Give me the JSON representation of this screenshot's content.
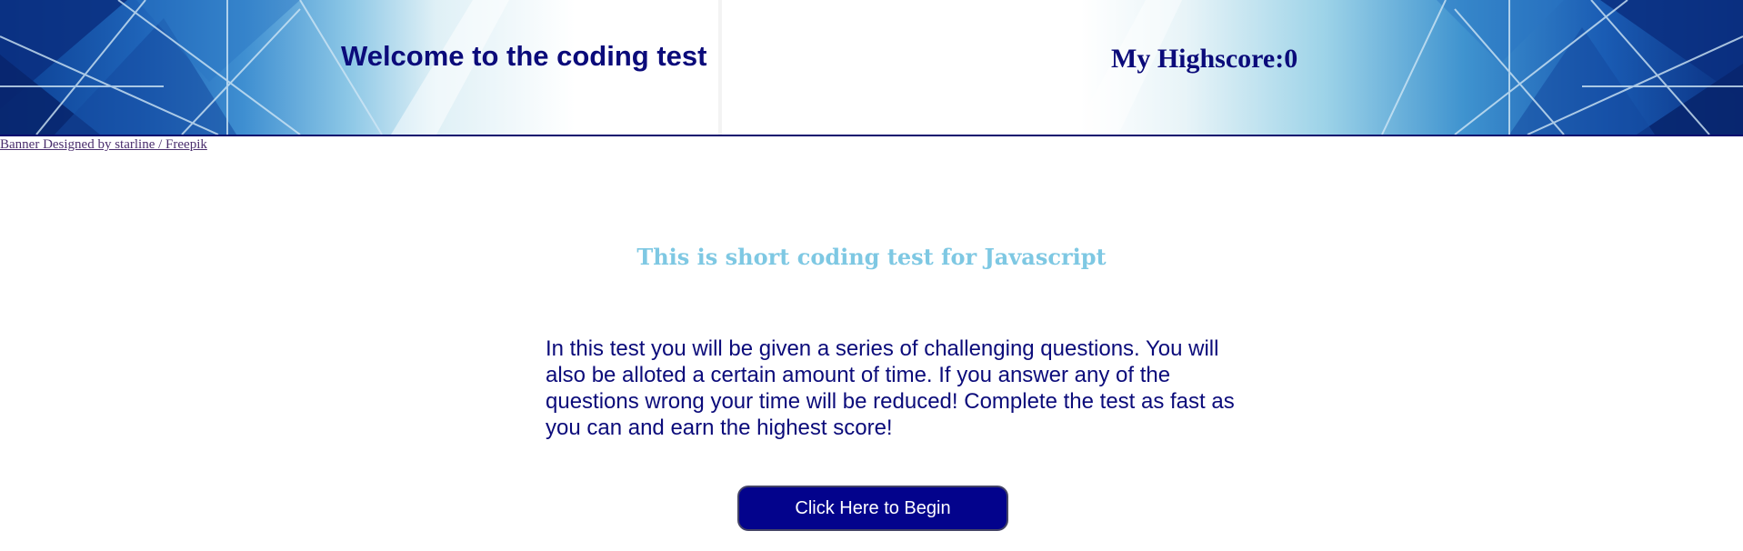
{
  "banner": {
    "title": "Welcome to the coding test",
    "highscore_label": "My Highscore:0",
    "credit_link": "Banner Designed by starline / Freepik"
  },
  "main": {
    "subtitle": "This is short coding test for Javascript",
    "intro": "In this test you will be given a series of challenging questions. You will also be alloted a certain amount of time. If you answer any of the questions wrong your time will be reduced! Complete the test as fast as you can and earn the highest score!",
    "begin_button": "Click Here to Begin"
  },
  "colors": {
    "title_navy": "#0b0b7a",
    "subtitle_sky": "#7ec8e3",
    "button_bg": "#03038c",
    "button_text": "#ffffff",
    "credit_link": "#4b2f6e"
  }
}
